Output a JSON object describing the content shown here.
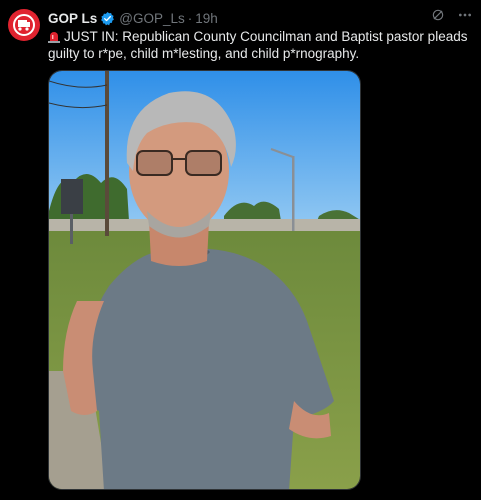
{
  "author": {
    "name": "GOP Ls",
    "handle": "@GOP_Ls",
    "separator": "·",
    "time": "19h"
  },
  "tweet": {
    "text": "JUST IN: Republican County Councilman and Baptist pastor pleads guilty to r*pe, child m*lesting, and child p*rnography."
  },
  "icons": {
    "verified": "verified-badge-icon",
    "siren": "siren-emoji-icon",
    "grok": "grok-icon",
    "more": "more-options-icon"
  },
  "colors": {
    "background": "#000000",
    "text": "#e7e9ea",
    "muted": "#71767b",
    "verified": "#1d9bf0",
    "avatar": "#e0232f"
  }
}
